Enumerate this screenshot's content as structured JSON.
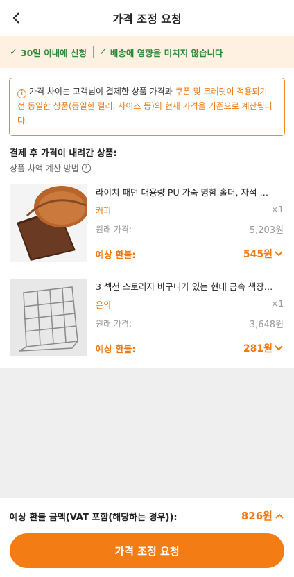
{
  "header": {
    "title": "가격 조정 요청"
  },
  "banner": {
    "item1": "30일 이내에 신청",
    "item2": "배송에 영향을 미치지 않습니다"
  },
  "notice": {
    "part1": "가격 차이는 고객님이 결제한 상품 가격과 ",
    "part2": "쿠폰 및 크레딧이 적용되기 전 동일한 상품(동일한 컬러, 사이즈 등)의 현재 가격을 기준으로 계산됩니다."
  },
  "section": {
    "title": "결제 후 가격이 내려간 상품:",
    "calc_label": "상품 차액 계산 방법"
  },
  "products": [
    {
      "name": "라이치 패턴 대용량 PU 가죽 명함 홀더, 자석 …",
      "variant": "커피",
      "qty": "×1",
      "original_label": "원래 가격:",
      "original_price": "5,203원",
      "refund_label": "예상 환불:",
      "refund_price": "545원"
    },
    {
      "name": "3 섹션 스토리지 바구니가 있는 현대 금속 책장…",
      "variant": "은의",
      "qty": "×1",
      "original_label": "원래 가격:",
      "original_price": "3,648원",
      "refund_label": "예상 환불:",
      "refund_price": "281원"
    }
  ],
  "footer": {
    "total_label": "예상 환불 금액(VAT 포함(해당하는 경우)):",
    "total_value": "826원",
    "submit_label": "가격 조정 요청"
  },
  "colors": {
    "accent": "#f47c14",
    "success": "#2e8a3a",
    "banner_bg": "#fff1e2"
  }
}
